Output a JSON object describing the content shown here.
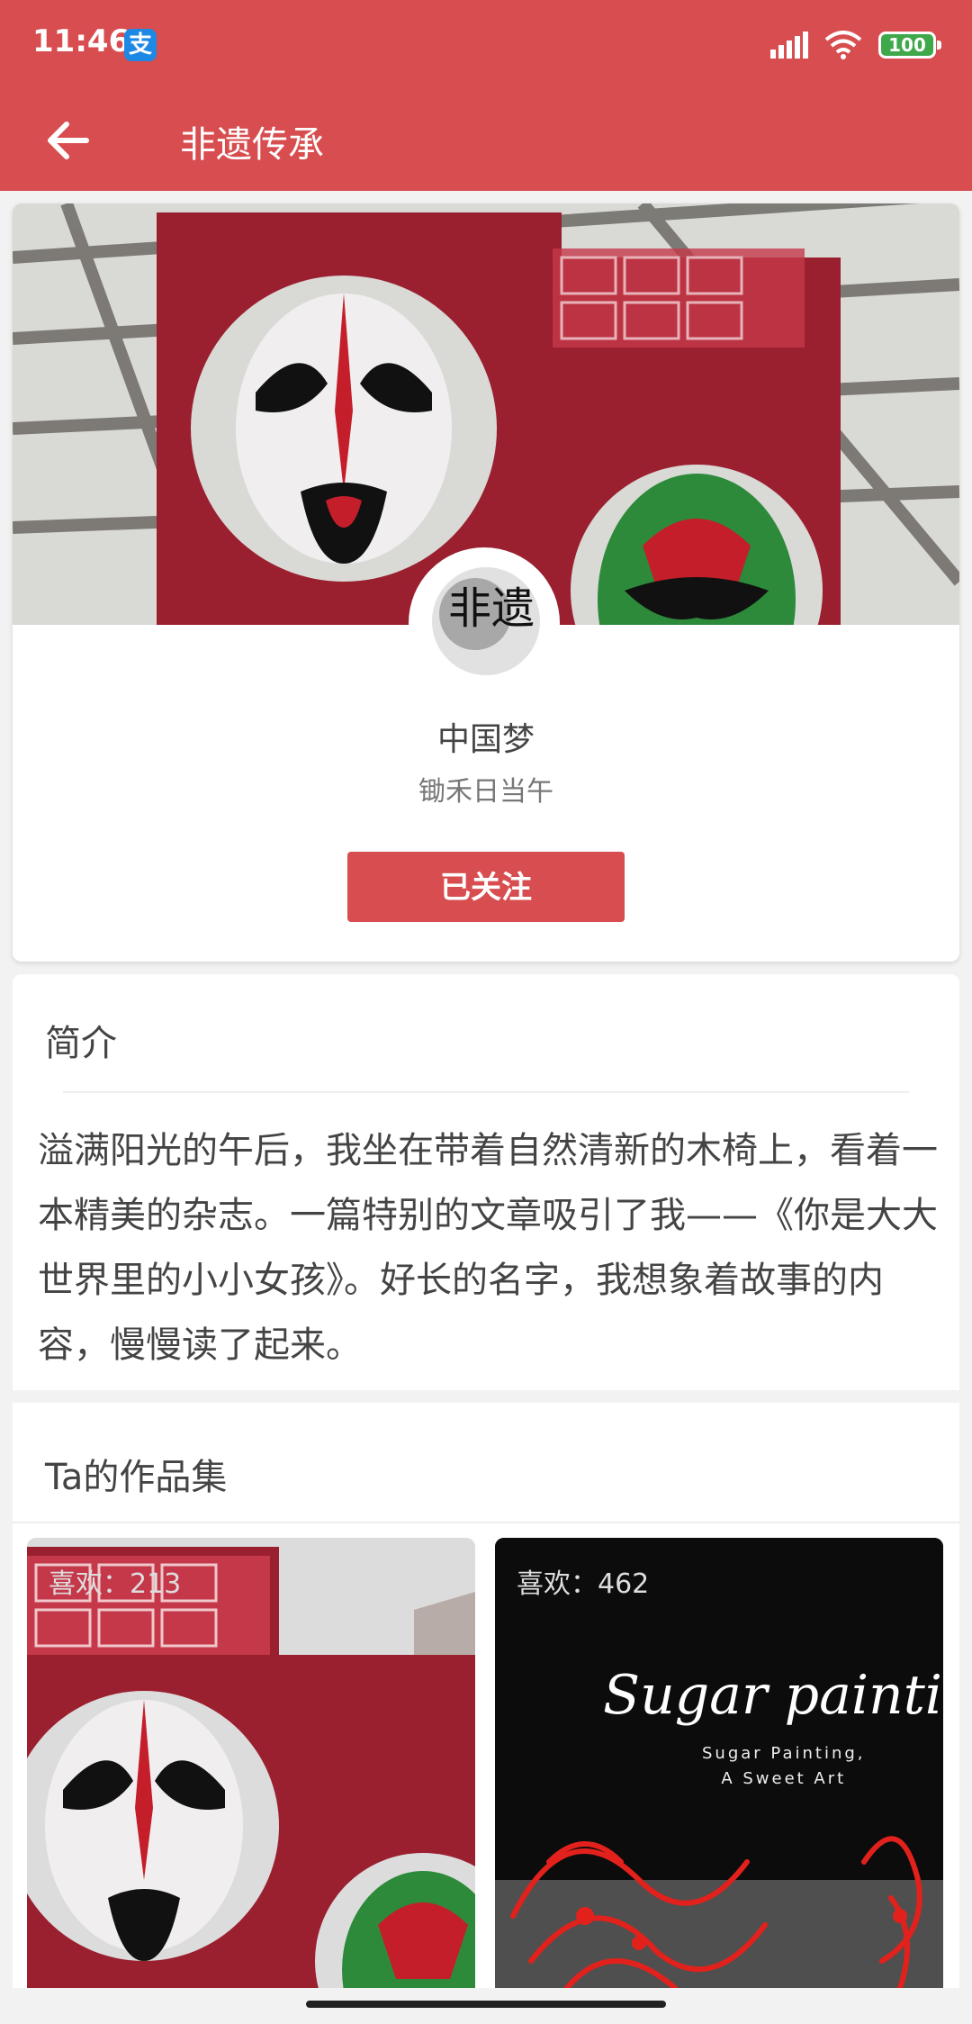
{
  "status_bar": {
    "time": "11:46",
    "alipay_glyph": "支",
    "battery": "100"
  },
  "app_bar": {
    "title": "非遗传承",
    "back_icon": "back-arrow-icon"
  },
  "profile": {
    "name": "中国梦",
    "subtitle": "锄禾日当午",
    "follow_label": "已关注",
    "avatar_text": "非遗"
  },
  "intro": {
    "title": "简介",
    "text": "溢满阳光的午后，我坐在带着自然清新的木椅上，看着一本精美的杂志。一篇特别的文章吸引了我——《你是大大世界里的小小女孩》。好长的名字，我想象着故事的内容，慢慢读了起来。"
  },
  "works": {
    "title": "Ta的作品集",
    "items": [
      {
        "likes": "喜欢：213"
      },
      {
        "likes": "喜欢：462",
        "overlay_title": "Sugar painting",
        "overlay_sub1": "Sugar Painting,",
        "overlay_sub2": "A Sweet Art"
      }
    ]
  },
  "colors": {
    "primary": "#d84d4f"
  }
}
